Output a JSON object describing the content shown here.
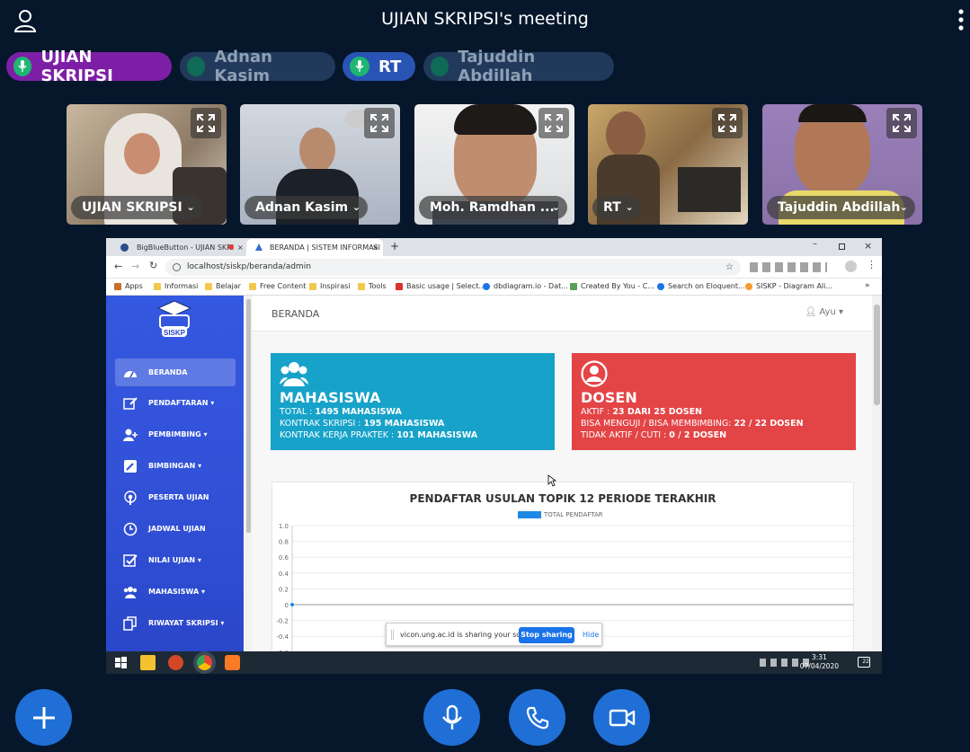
{
  "meeting": {
    "title": "UJIAN SKRIPSI's meeting"
  },
  "talkers": [
    {
      "name": "UJIAN SKRIPSI",
      "active": true
    },
    {
      "name": "Adnan Kasim",
      "active": false
    },
    {
      "name": "RT",
      "active": true
    },
    {
      "name": "Tajuddin Abdillah",
      "active": false
    }
  ],
  "videos": [
    {
      "name": "UJIAN SKRIPSI"
    },
    {
      "name": "Adnan Kasim"
    },
    {
      "name": "Moh. Ramdhan ..."
    },
    {
      "name": "RT"
    },
    {
      "name": "Tajuddin Abdillah"
    }
  ],
  "browser": {
    "tabs": [
      {
        "label": "BigBlueButton - UJIAN SKRI"
      },
      {
        "label": "BERANDA | SISTEM INFORMASI"
      }
    ],
    "url": "localhost/siskp/beranda/admin",
    "bookmarks": [
      "Apps",
      "Informasi",
      "Belajar",
      "Free Content",
      "Inspirasi",
      "Tools",
      "Basic usage | Select...",
      "dbdiagram.io - Dat...",
      "Created By You - C...",
      "Search on Eloquent...",
      "SISKP - Diagram Ali..."
    ]
  },
  "app": {
    "logo_text": "SISKP",
    "menu": [
      {
        "label": "BERANDA",
        "icon": "dashboard-icon",
        "active": true
      },
      {
        "label": "PENDAFTARAN",
        "icon": "edit-icon",
        "dropdown": true
      },
      {
        "label": "PEMBIMBING",
        "icon": "add-user-icon",
        "dropdown": true
      },
      {
        "label": "BIMBINGAN",
        "icon": "pencil-icon",
        "dropdown": true
      },
      {
        "label": "PESERTA UJIAN",
        "icon": "podcast-icon"
      },
      {
        "label": "JADWAL UJIAN",
        "icon": "clock-icon"
      },
      {
        "label": "NILAI UJIAN",
        "icon": "check-square-icon",
        "dropdown": true
      },
      {
        "label": "MAHASISWA",
        "icon": "users-icon",
        "dropdown": true
      },
      {
        "label": "RIWAYAT SKRIPSI",
        "icon": "copy-icon",
        "dropdown": true
      }
    ],
    "page_title": "BERANDA",
    "user": "Ayu",
    "cards": {
      "mahasiswa": {
        "title": "MAHASISWA",
        "lines": [
          {
            "label": "TOTAL : ",
            "value": "1495 MAHASISWA"
          },
          {
            "label": "KONTRAK SKRIPSI : ",
            "value": "195 MAHASISWA"
          },
          {
            "label": "KONTRAK KERJA PRAKTEK : ",
            "value": "101 MAHASISWA"
          }
        ],
        "color": "#17a2c9"
      },
      "dosen": {
        "title": "DOSEN",
        "lines": [
          {
            "label": "AKTIF : ",
            "value": "23 DARI 25 DOSEN"
          },
          {
            "label": "BISA MENGUJI / BISA MEMBIMBING: ",
            "value": "22 / 22 DOSEN"
          },
          {
            "label": "TIDAK AKTIF / CUTI : ",
            "value": "0 / 2 DOSEN"
          }
        ],
        "color": "#e34446"
      }
    },
    "chart_data": {
      "type": "line",
      "title": "PENDAFTAR USULAN TOPIK 12 PERIODE TERAKHIR",
      "series": [
        {
          "name": "TOTAL PENDAFTAR",
          "values": [
            0
          ]
        }
      ],
      "yticks": [
        "1.0",
        "0.8",
        "0.6",
        "0.4",
        "0.2",
        "0",
        "-0.2",
        "-0.4",
        "-0.6"
      ],
      "ylim": [
        -0.6,
        1.0
      ],
      "grid": true,
      "legend": "top-center",
      "color": "#1e88e5"
    }
  },
  "share_notice": {
    "message": "vicon.ung.ac.id is sharing your screen.",
    "stop": "Stop sharing",
    "hide": "Hide"
  },
  "taskbar": {
    "time": "3:31",
    "date": "07/04/2020",
    "notifications": "22"
  },
  "controls": [
    "plus-icon",
    "microphone-icon",
    "phone-icon",
    "video-camera-icon"
  ]
}
